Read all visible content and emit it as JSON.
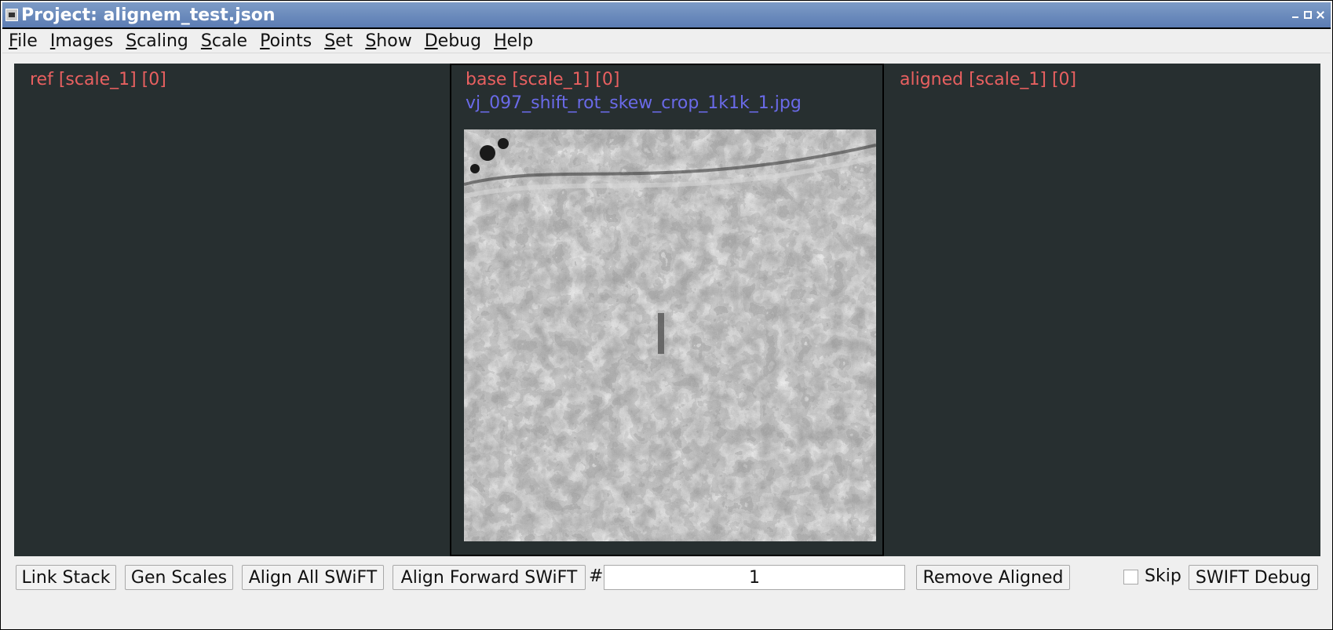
{
  "window": {
    "title": "Project: alignem_test.json"
  },
  "menu": {
    "items": [
      {
        "label": "File",
        "mnemonic": "F"
      },
      {
        "label": "Images",
        "mnemonic": "I"
      },
      {
        "label": "Scaling",
        "mnemonic": "S"
      },
      {
        "label": "Scale",
        "mnemonic": "S"
      },
      {
        "label": "Points",
        "mnemonic": "P"
      },
      {
        "label": "Set",
        "mnemonic": "S"
      },
      {
        "label": "Show",
        "mnemonic": "S"
      },
      {
        "label": "Debug",
        "mnemonic": "D"
      },
      {
        "label": "Help",
        "mnemonic": "H"
      }
    ]
  },
  "panes": {
    "ref": {
      "label": "ref [scale_1] [0]"
    },
    "base": {
      "label": "base [scale_1] [0]",
      "filename": "vj_097_shift_rot_skew_crop_1k1k_1.jpg"
    },
    "aligned": {
      "label": "aligned [scale_1] [0]"
    }
  },
  "toolbar": {
    "link_stack": "Link Stack",
    "gen_scales": "Gen Scales",
    "align_all": "Align All SWiFT",
    "align_forward": "Align Forward SWiFT",
    "hash": "#",
    "count_value": "1",
    "remove_aligned": "Remove Aligned",
    "skip_label": "Skip",
    "skip_checked": false,
    "swift_debug": "SWIFT Debug"
  },
  "colors": {
    "pane_bg": "#272f30",
    "label_red": "#e86060",
    "filename_blue": "#6a6ae8",
    "titlebar": "#5b7cb3"
  }
}
